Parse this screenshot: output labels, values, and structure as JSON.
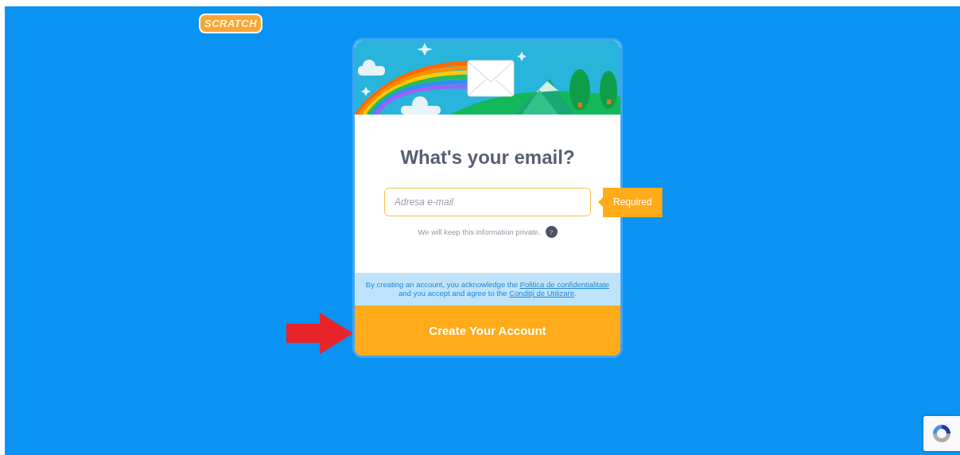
{
  "logo": {
    "text": "SCRATCH"
  },
  "form": {
    "title": "What's your email?",
    "email": {
      "placeholder": "Adresa e-mail"
    },
    "validation": {
      "text": "Required"
    },
    "privacy_note": "We will keep this information private.",
    "help": {
      "glyph": "?"
    },
    "legal": {
      "text_before": "By creating an account, you acknowledge the ",
      "privacy_link": "Politica de confidentialitate",
      "text_middle": " and you accept and agree to the ",
      "terms_link": "Condiţii de Utilizare",
      "text_after": "."
    },
    "submit": {
      "label": "Create Your Account"
    }
  }
}
